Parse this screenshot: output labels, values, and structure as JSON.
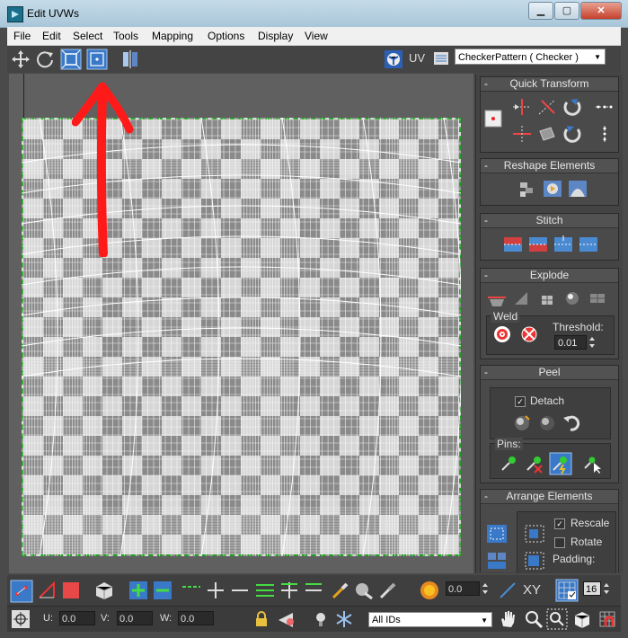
{
  "window": {
    "title": "Edit UVWs",
    "minimize": "▁",
    "maximize": "▢",
    "close": "✕"
  },
  "menu": [
    "File",
    "Edit",
    "Select",
    "Tools",
    "Mapping",
    "Options",
    "Display",
    "View"
  ],
  "toolbar": {
    "uv_label": "UV",
    "texture": "CheckerPattern  ( Checker )"
  },
  "panel": {
    "quick_transform": "Quick Transform",
    "reshape": "Reshape Elements",
    "stitch": "Stitch",
    "explode": "Explode",
    "weld": "Weld",
    "threshold_label": "Threshold:",
    "threshold_value": "0.01",
    "peel": "Peel",
    "detach": "Detach",
    "pins": "Pins:",
    "arrange": "Arrange Elements",
    "rescale": "Rescale",
    "rotate": "Rotate",
    "padding": "Padding:"
  },
  "bottom": {
    "angle_value": "0.0",
    "xy_label": "XY",
    "grid_value": "16",
    "u_label": "U:",
    "u_value": "0.0",
    "v_label": "V:",
    "v_value": "0.0",
    "w_label": "W:",
    "w_value": "0.0",
    "ids": "All IDs"
  },
  "colors": {
    "accent": "#3a78c8",
    "annotation": "#ff1a1a",
    "sheet_border": "#1f9e1f"
  }
}
